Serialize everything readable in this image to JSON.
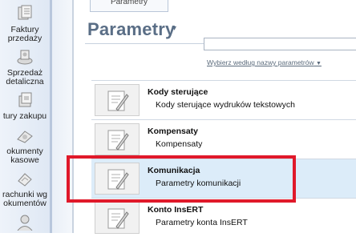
{
  "nav": {
    "items": [
      {
        "label": "Faktury\nprzedaży",
        "icon": "invoice-icon"
      },
      {
        "label": "Sprzedaż\ndetaliczna",
        "icon": "retail-sale-icon"
      },
      {
        "label": "tury zakupu",
        "icon": "purchase-invoice-icon"
      },
      {
        "label": "okumenty\nkasowe",
        "icon": "cash-document-icon"
      },
      {
        "label": "rachunki wg\nokumentów",
        "icon": "bills-icon"
      },
      {
        "label": "",
        "icon": "user-icon"
      }
    ]
  },
  "tab": {
    "label": "Parametry"
  },
  "header": {
    "title": "Parametry",
    "title_arrow": "▾"
  },
  "search": {
    "placeholder": "",
    "value": ""
  },
  "filter": {
    "label": "Wybierz według nazwy parametrów",
    "arrow": "▼"
  },
  "list": {
    "items": [
      {
        "name": "Kody sterujące",
        "desc": "Kody sterujące wydruków tekstowych",
        "icon": "settings-doc-icon"
      },
      {
        "name": "Kompensaty",
        "desc": "Kompensaty",
        "icon": "settings-doc-icon"
      },
      {
        "name": "Komunikacja",
        "desc": "Parametry komunikacji",
        "icon": "settings-doc-icon",
        "selected": true
      },
      {
        "name": "Konto InsERT",
        "desc": "Parametry konta InsERT",
        "icon": "settings-doc-icon"
      }
    ]
  },
  "colors": {
    "highlight": "#e0192a",
    "selected_row": "#dcecf9",
    "title": "#5a6e86"
  }
}
